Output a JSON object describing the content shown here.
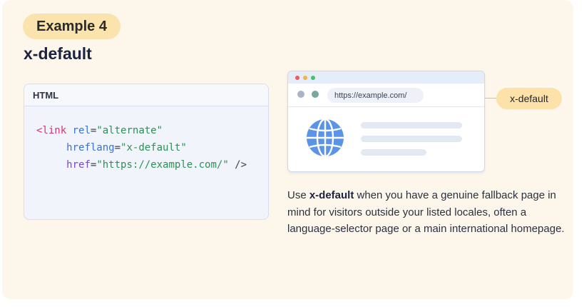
{
  "header": {
    "example_label": "Example 4",
    "title": "x-default"
  },
  "code": {
    "language": "HTML",
    "line1": {
      "tag": "<link",
      "attr": "rel",
      "eq": "=",
      "value": "\"alternate\""
    },
    "line2": {
      "attr": "hreflang",
      "eq": "=",
      "value": "\"x-default\""
    },
    "line3": {
      "attr": "href",
      "eq": "=",
      "value": "\"https://example.com/\"",
      "close": " />"
    }
  },
  "browser": {
    "url": "https://example.com/",
    "globe_icon": "globe-icon"
  },
  "badge": {
    "label": "x-default"
  },
  "description": {
    "prefix": "Use ",
    "bold": "x-default",
    "suffix": " when you have a genuine fallback page in mind for visitors outside your listed locales, often a language-selector page or a main international homepage."
  },
  "colors": {
    "background": "#fdf6ea",
    "pill": "#fbe3ad",
    "tag": "#d1347a",
    "attribute": "#3a71d8",
    "string": "#2f8e55",
    "globe": "#5b93e6"
  }
}
